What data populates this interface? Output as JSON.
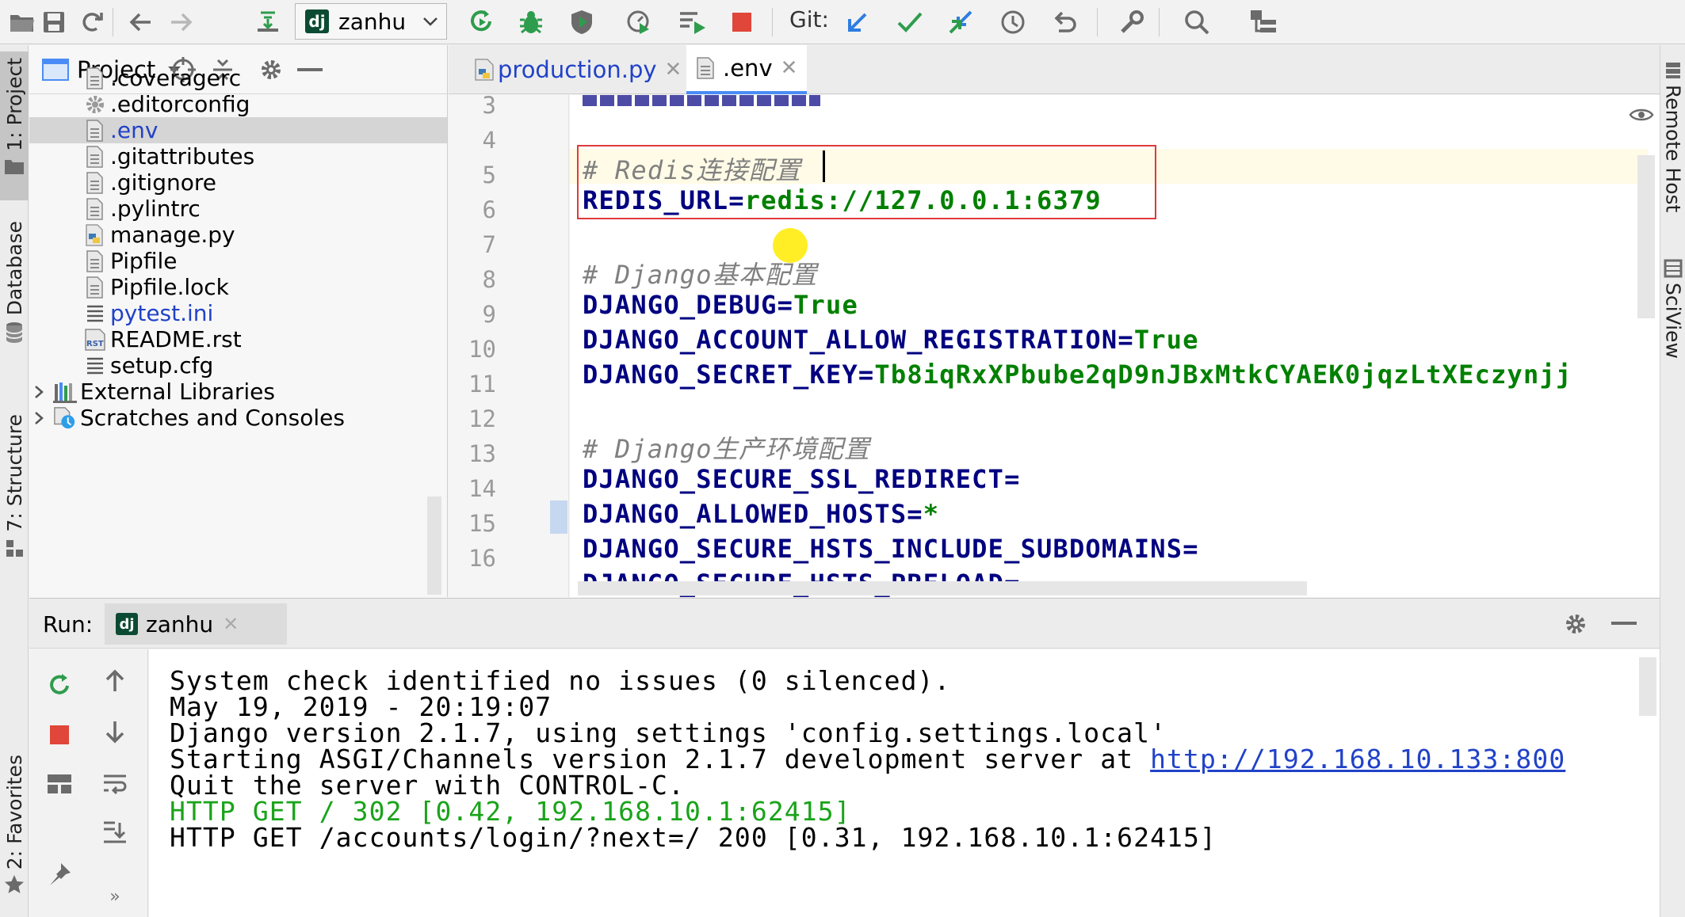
{
  "toolbar": {
    "run_config": "zanhu",
    "git_label": "Git:"
  },
  "left_tabs": {
    "project": "1: Project",
    "database": "Database",
    "structure": "7: Structure",
    "favorites": "2: Favorites"
  },
  "right_tabs": {
    "remote_host": "Remote Host",
    "sciview": "SciView"
  },
  "project_panel": {
    "title": "Project",
    "items": [
      {
        "label": ".coveragerc",
        "icon": "text-file-icon"
      },
      {
        "label": ".editorconfig",
        "icon": "gear-file-icon"
      },
      {
        "label": ".env",
        "icon": "text-file-icon",
        "selected": true
      },
      {
        "label": ".gitattributes",
        "icon": "text-file-icon"
      },
      {
        "label": ".gitignore",
        "icon": "text-file-icon"
      },
      {
        "label": ".pylintrc",
        "icon": "text-file-icon"
      },
      {
        "label": "manage.py",
        "icon": "python-file-icon"
      },
      {
        "label": "Pipfile",
        "icon": "text-file-icon"
      },
      {
        "label": "Pipfile.lock",
        "icon": "text-file-icon"
      },
      {
        "label": "pytest.ini",
        "icon": "ini-file-icon"
      },
      {
        "label": "README.rst",
        "icon": "rst-file-icon"
      },
      {
        "label": "setup.cfg",
        "icon": "ini-file-icon"
      },
      {
        "label": "External Libraries",
        "icon": "library-icon"
      },
      {
        "label": "Scratches and Consoles",
        "icon": "scratches-icon"
      }
    ]
  },
  "editor": {
    "tabs": [
      {
        "label": "production.py",
        "active": false
      },
      {
        "label": ".env",
        "active": true
      }
    ],
    "line_numbers": [
      "3",
      "4",
      "5",
      "6",
      "7",
      "8",
      "9",
      "10",
      "11",
      "12",
      "13",
      "14",
      "15",
      "16"
    ],
    "lines": {
      "l4_comment": "# Redis连接配置",
      "l5_key": "REDIS_URL=",
      "l5_val": "redis://127.0.0.1:6379",
      "l7_comment": "# Django基本配置",
      "l8_key": "DJANGO_DEBUG=",
      "l8_val": "True",
      "l9_key": "DJANGO_ACCOUNT_ALLOW_REGISTRATION=",
      "l9_val": "True",
      "l10_key": "DJANGO_SECRET_KEY=",
      "l10_val": "Tb8iqRxXPbube2qD9nJBxMtkCYAEK0jqzLtXEczynjj",
      "l12_comment": "# Django生产环境配置",
      "l13_key": "DJANGO_SECURE_SSL_REDIRECT=",
      "l14_key": "DJANGO_ALLOWED_HOSTS=",
      "l14_val": "*",
      "l15_key": "DJANGO_SECURE_HSTS_INCLUDE_SUBDOMAINS=",
      "l16_key": "DJANGO_SECURE_HSTS_PRELOAD="
    }
  },
  "run_panel": {
    "label": "Run:",
    "tab": "zanhu",
    "console": {
      "l1": "System check identified no issues (0 silenced).",
      "l2": "May 19, 2019 - 20:19:07",
      "l3": "Django version 2.1.7, using settings 'config.settings.local'",
      "l4_text": "Starting ASGI/Channels version 2.1.7 development server at ",
      "l4_link": "http://192.168.10.133:800",
      "l5": "Quit the server with CONTROL-C.",
      "l6": "HTTP GET / 302 [0.42, 192.168.10.1:62415]",
      "l7": "HTTP GET /accounts/login/?next=/ 200 [0.31, 192.168.10.1:62415]"
    }
  },
  "colors": {
    "accent": "#4a8cf7",
    "key": "#000080",
    "string": "#008000",
    "comment": "#808080",
    "console_green": "#1aa31a",
    "link": "#2142c8",
    "highlight_box": "#e03a3a"
  }
}
